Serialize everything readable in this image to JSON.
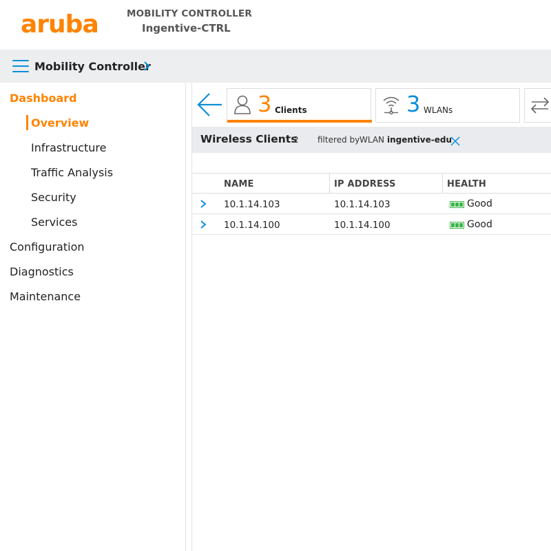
{
  "header": {
    "logo": "aruba",
    "controller_kind": "MOBILITY CONTROLLER",
    "controller_name": "Ingentive-CTRL"
  },
  "breadcrumb": {
    "title": "Mobility Controller"
  },
  "sidebar": {
    "items": [
      {
        "label": "Dashboard"
      },
      {
        "label": "Overview"
      },
      {
        "label": "Infrastructure"
      },
      {
        "label": "Traffic Analysis"
      },
      {
        "label": "Security"
      },
      {
        "label": "Services"
      },
      {
        "label": "Configuration"
      },
      {
        "label": "Diagnostics"
      },
      {
        "label": "Maintenance"
      }
    ]
  },
  "tiles": {
    "clients": {
      "count": "3",
      "label": "Clients"
    },
    "wlans": {
      "count": "3",
      "label": "WLANs"
    }
  },
  "filterbar": {
    "title": "Wireless Clients",
    "count": "2",
    "filtered_by": "filtered by",
    "key": "WLAN",
    "value": "ingentive-edu"
  },
  "table": {
    "columns": {
      "name": "NAME",
      "ip": "IP ADDRESS",
      "health": "HEALTH"
    },
    "rows": [
      {
        "name": "10.1.14.103",
        "ip": "10.1.14.103",
        "health": "Good"
      },
      {
        "name": "10.1.14.100",
        "ip": "10.1.14.100",
        "health": "Good"
      }
    ]
  },
  "colors": {
    "accent_orange": "#ff8300",
    "accent_blue": "#0b8ed8",
    "health_good": "#3bb54a"
  }
}
